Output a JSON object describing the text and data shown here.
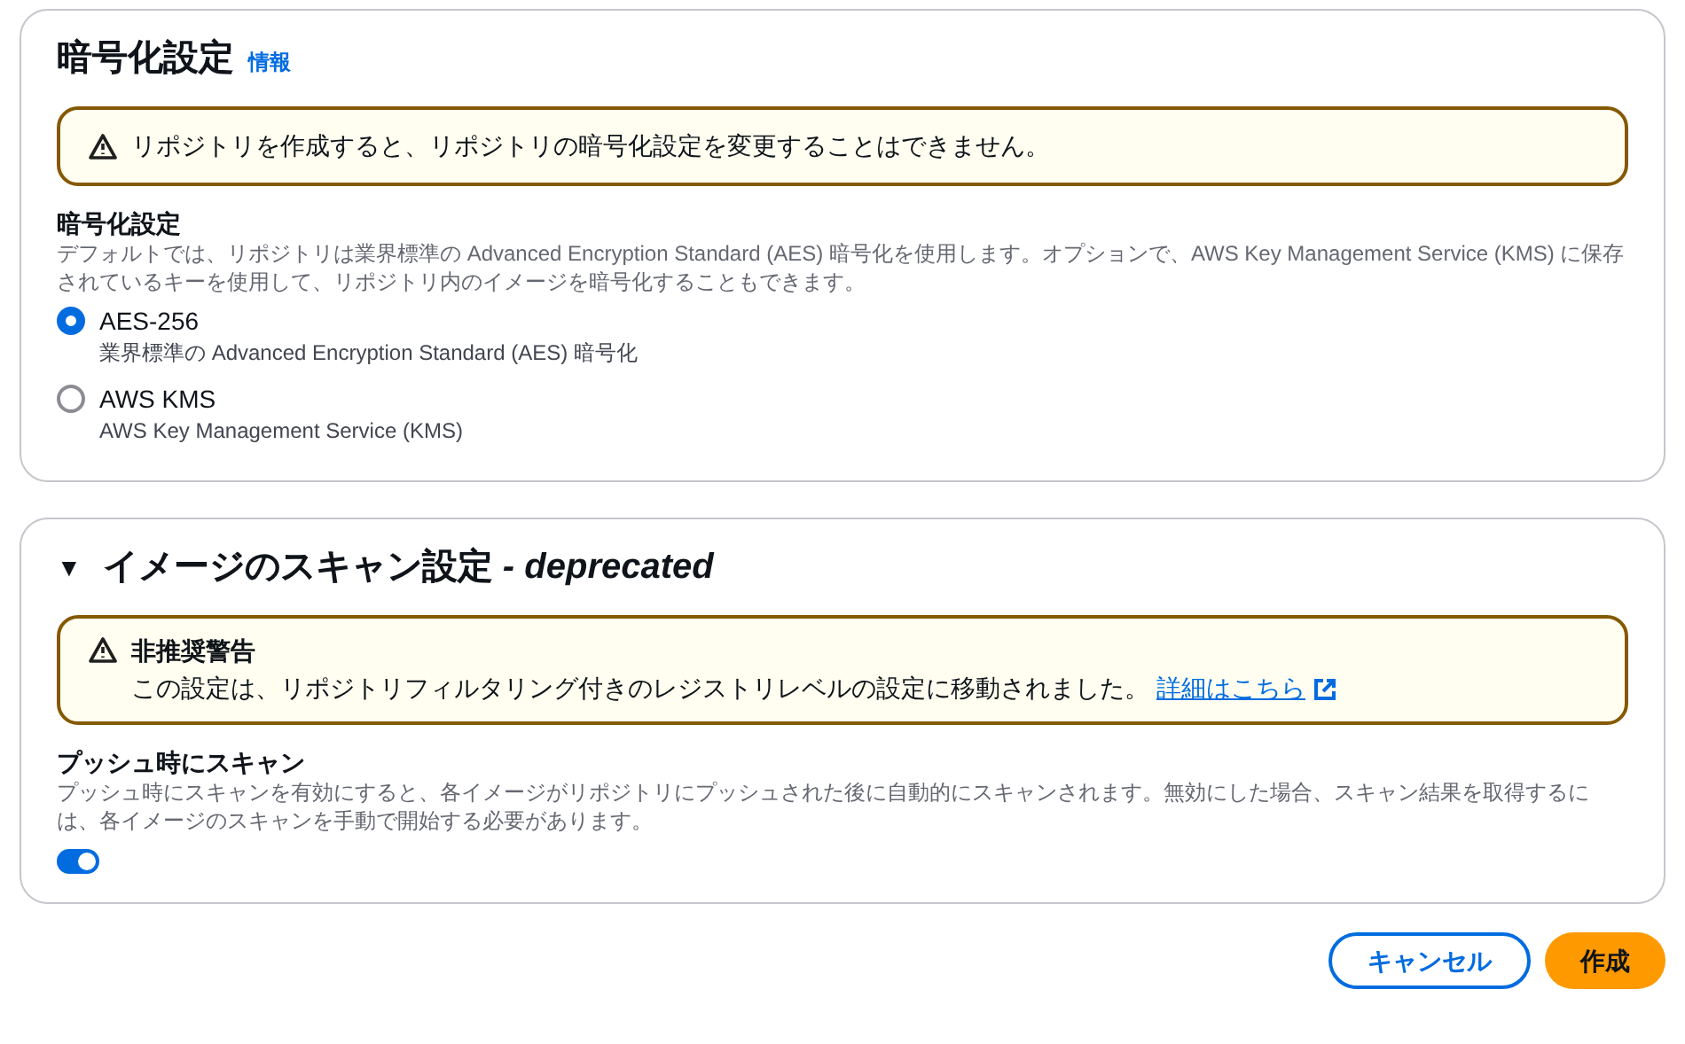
{
  "encryption": {
    "title": "暗号化設定",
    "info_link": "情報",
    "warning": "リポジトリを作成すると、リポジトリの暗号化設定を変更することはできません。",
    "label": "暗号化設定",
    "description": "デフォルトでは、リポジトリは業界標準の Advanced Encryption Standard (AES) 暗号化を使用します。オプションで、AWS Key Management Service (KMS) に保存されているキーを使用して、リポジトリ内のイメージを暗号化することもできます。",
    "options": [
      {
        "label": "AES-256",
        "description": "業界標準の Advanced Encryption Standard (AES) 暗号化",
        "selected": true
      },
      {
        "label": "AWS KMS",
        "description": "AWS Key Management Service (KMS)",
        "selected": false
      }
    ]
  },
  "scan": {
    "expanded": true,
    "expand_icon": "▼",
    "title": "イメージのスキャン設定 *- deprecated*",
    "warning_title": "非推奨警告",
    "warning_text": "この設定は、リポジトリフィルタリング付きのレジストリレベルの設定に移動されました。",
    "warning_link": "詳細はこちら",
    "label": "プッシュ時にスキャン",
    "description": "プッシュ時にスキャンを有効にすると、各イメージがリポジトリにプッシュされた後に自動的にスキャンされます。無効にした場合、スキャン結果を取得するには、各イメージのスキャンを手動で開始する必要があります。",
    "on": true
  },
  "buttons": [
    {
      "label": "キャンセル",
      "kind": "secondary"
    },
    {
      "label": "作成",
      "kind": "primary"
    }
  ]
}
